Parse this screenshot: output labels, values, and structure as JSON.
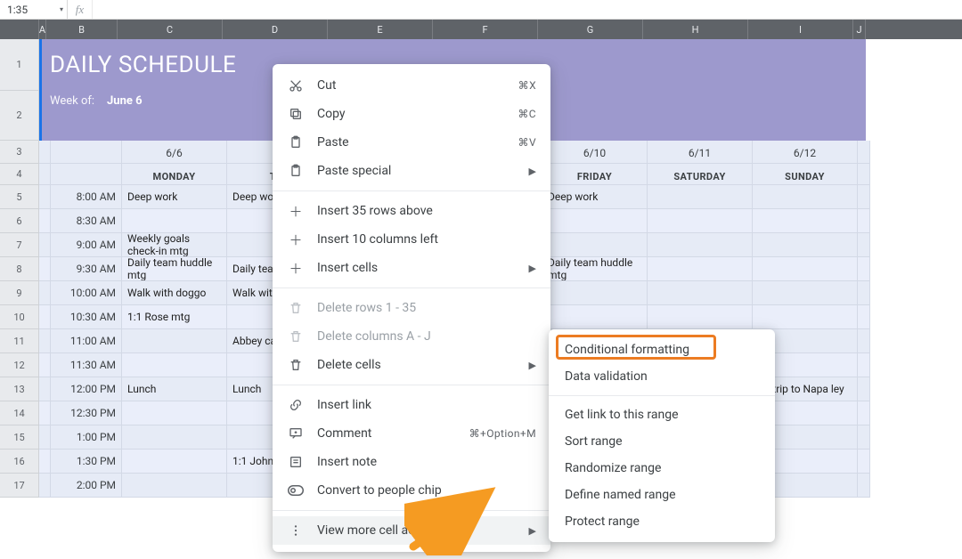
{
  "name_box": "1:35",
  "fx": "fx",
  "formula_value": "",
  "columns": [
    "A",
    "B",
    "C",
    "D",
    "E",
    "F",
    "G",
    "H",
    "I",
    "J"
  ],
  "row_headers": [
    1,
    2,
    3,
    4,
    5,
    6,
    7,
    8,
    9,
    10,
    11,
    12,
    13,
    14,
    15,
    16,
    17
  ],
  "hero": {
    "title": "DAILY SCHEDULE",
    "week_of_label": "Week of:",
    "week_of_value": "June 6"
  },
  "day_headers": [
    {
      "date": "6/6",
      "dow": "MONDAY"
    },
    {
      "date": "",
      "dow": "TUE"
    },
    {
      "date": "",
      "dow": ""
    },
    {
      "date": "",
      "dow": ""
    },
    {
      "date": "6/10",
      "dow": "FRIDAY"
    },
    {
      "date": "6/11",
      "dow": "SATURDAY"
    },
    {
      "date": "6/12",
      "dow": "SUNDAY"
    }
  ],
  "rows": [
    {
      "time": "8:00 AM",
      "C": "Deep work",
      "D": "Deep wo",
      "G": "Deep work",
      "I": ""
    },
    {
      "time": "8:30 AM",
      "C": "",
      "D": "",
      "G": "",
      "I": ""
    },
    {
      "time": "9:00 AM",
      "C": "Weekly goals check-in mtg",
      "D": "",
      "G": "",
      "I": ""
    },
    {
      "time": "9:30 AM",
      "C": "Daily team huddle mtg",
      "D": "Daily tea mtg",
      "G": "Daily team huddle mtg",
      "I": ""
    },
    {
      "time": "10:00 AM",
      "C": "Walk with doggo",
      "D": "Walk wit",
      "G": "",
      "I": ""
    },
    {
      "time": "10:30 AM",
      "C": "1:1 Rose mtg",
      "D": "",
      "G": "",
      "I": ""
    },
    {
      "time": "11:00 AM",
      "C": "",
      "D": "Abbey ca progress",
      "G": "",
      "I": ""
    },
    {
      "time": "11:30 AM",
      "C": "",
      "D": "",
      "G": "",
      "I": ""
    },
    {
      "time": "12:00 PM",
      "C": "Lunch",
      "D": "Lunch",
      "G": "",
      "I": "ad trip to Napa ley"
    },
    {
      "time": "12:30 PM",
      "C": "",
      "D": "",
      "G": "",
      "I": ""
    },
    {
      "time": "1:00 PM",
      "C": "",
      "D": "",
      "G": "",
      "I": ""
    },
    {
      "time": "1:30 PM",
      "C": "",
      "D": "1:1 John",
      "G": "",
      "I": ""
    },
    {
      "time": "2:00 PM",
      "C": "",
      "D": "",
      "G": "",
      "I": ""
    }
  ],
  "menu": {
    "cut": {
      "label": "Cut",
      "accel": "⌘X"
    },
    "copy": {
      "label": "Copy",
      "accel": "⌘C"
    },
    "paste": {
      "label": "Paste",
      "accel": "⌘V"
    },
    "paste_special": {
      "label": "Paste special"
    },
    "insert_rows": {
      "label": "Insert 35 rows above"
    },
    "insert_cols": {
      "label": "Insert 10 columns left"
    },
    "insert_cells": {
      "label": "Insert cells"
    },
    "delete_rows": {
      "label": "Delete rows 1 - 35"
    },
    "delete_cols": {
      "label": "Delete columns A - J"
    },
    "delete_cells": {
      "label": "Delete cells"
    },
    "insert_link": {
      "label": "Insert link"
    },
    "comment": {
      "label": "Comment",
      "accel": "⌘+Option+M"
    },
    "insert_note": {
      "label": "Insert note"
    },
    "people_chip": {
      "label": "Convert to people chip"
    },
    "more": {
      "label": "View more cell actions"
    }
  },
  "submenu": {
    "cond_fmt": "Conditional formatting",
    "data_val": "Data validation",
    "get_link": "Get link to this range",
    "sort_range": "Sort range",
    "randomize": "Randomize range",
    "named_range": "Define named range",
    "protect": "Protect range"
  },
  "colors": {
    "accent": "#1a73e8",
    "hero": "#9d99cd",
    "highlight": "#ec7c22"
  }
}
